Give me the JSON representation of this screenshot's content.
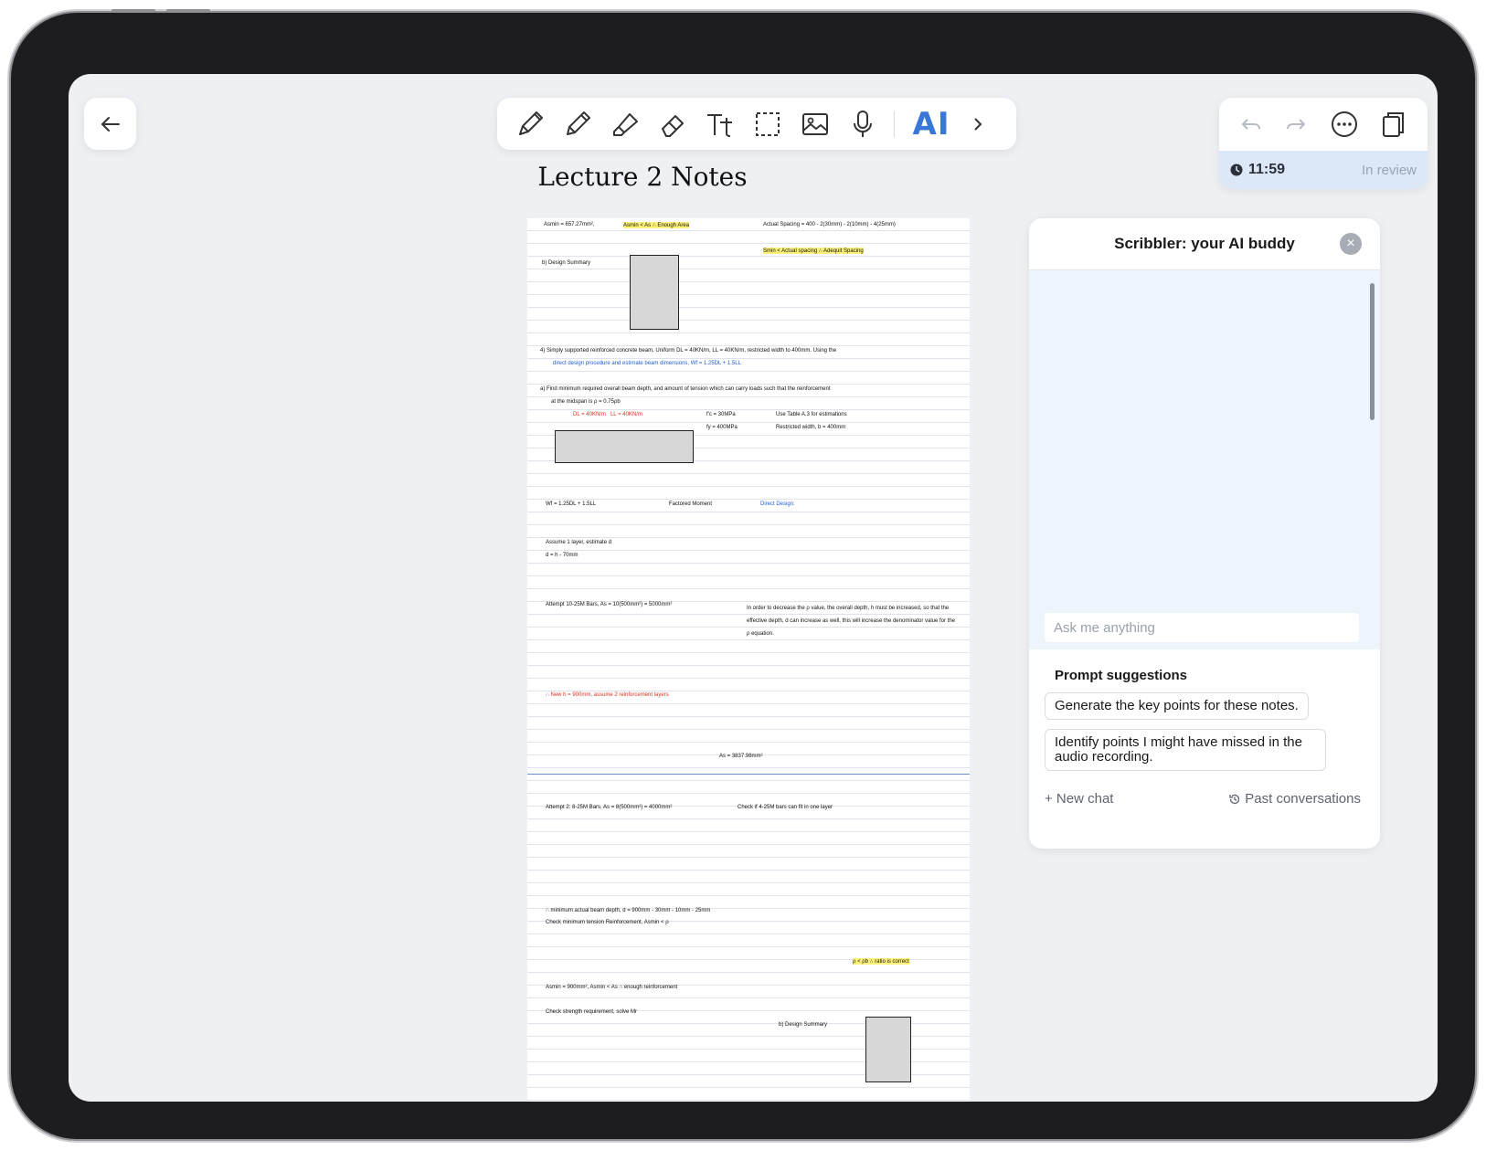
{
  "toolbar": {
    "tools": [
      "pen-icon",
      "pencil-icon",
      "highlighter-icon",
      "eraser-icon",
      "text-icon",
      "lasso-select-icon",
      "image-icon",
      "microphone-icon"
    ],
    "ai_label": "AI"
  },
  "status": {
    "time": "11:59",
    "state": "In review"
  },
  "document": {
    "title": "Lecture 2 Notes"
  },
  "ai_panel": {
    "title": "Scribbler: your AI buddy",
    "input_placeholder": "Ask me anything",
    "suggestions_title": "Prompt suggestions",
    "suggestions": [
      "Generate the key points for these notes.",
      "Identify points I might have missed in the audio recording."
    ],
    "new_chat": "+ New chat",
    "past_conversations": "Past conversations"
  },
  "notes": [
    "Asmin = 657.27mm²,",
    "Asmin < As ∴ Enough Area",
    "Actual Spacing = 400 - 2(30mm) - 2(10mm) - 4(25mm)",
    "Smin < Actual spacing ∴ Adequit Spacing",
    "b) Design Summary",
    "4) Simply supported reinforced concrete beam, Uniform DL = 40KN/m, LL = 40KN/m, restricted width to 400mm. Using the",
    "direct design procedure and estimate beam dimensions, Wf = 1.25DL + 1.5LL",
    "a) Find minimum required overall beam depth, and amount of tension which can carry loads such that the reinforcement",
    "at the midspan is ρ = 0.75ρb",
    "f'c = 30MPa",
    "fy = 400MPa",
    "Use Table A.3 for estimations",
    "Restricted width, b = 400mm",
    "Wf = 1.25DL + 1.5LL",
    "Factored Moment",
    "Direct Design:",
    "Assume 1 layer, estimate d",
    "d = h - 70mm",
    "Attempt 10-25M Bars, As = 10(500mm²) = 5000mm²",
    "In order to decrease the ρ value, the overall depth, h must be increased, so that the effective depth, d can increase as well, this will increase the denominator value for the ρ equation.",
    "∴ New h = 900mm, assume 2 reinforcement layers",
    "As = 3837.98mm²",
    "Attempt 2: 8-25M Bars, As = 8(500mm²) = 4000mm²",
    "Check if 4-25M bars can fit in one layer",
    "∴ minimum actual beam depth, d = 900mm - 30mm - 10mm - 25mm",
    "Check minimum tension Reinforcement, Asmin < ρ",
    "ρ < ρb ∴ ratio is correct",
    "Asmin = 900mm², Asmin < As ∴ enough reinforcement",
    "Check strength requirement, solve Mr",
    "b) Design Summary"
  ]
}
